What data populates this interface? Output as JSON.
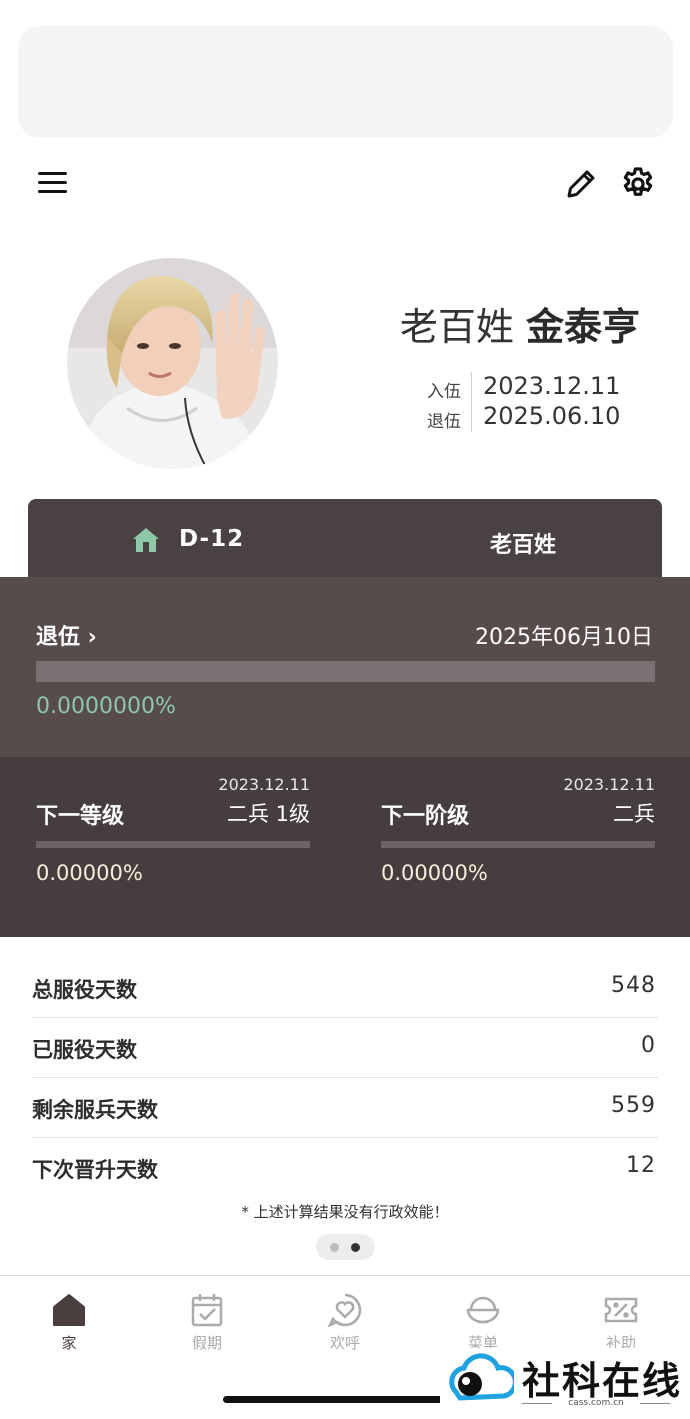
{
  "profile": {
    "rank_prefix": "老百姓",
    "name": "金泰亨",
    "enlist_label": "入伍",
    "enlist_date": "2023.12.11",
    "discharge_label": "退伍",
    "discharge_date": "2025.06.10"
  },
  "tabs": {
    "dday": "D-12",
    "rank": "老百姓"
  },
  "discharge": {
    "title": "退伍",
    "chevron": "›",
    "date": "2025年06月10日",
    "progress": 0.0,
    "percent_text": "0.0000000%"
  },
  "next_level": {
    "title": "下一等级",
    "date": "2023.12.11",
    "rank": "二兵 1级",
    "progress": 0.0,
    "percent_text": "0.00000%"
  },
  "next_stage": {
    "title": "下一阶级",
    "date": "2023.12.11",
    "rank": "二兵",
    "progress": 0.0,
    "percent_text": "0.00000%"
  },
  "stats": [
    {
      "label": "总服役天数",
      "value": "548"
    },
    {
      "label": "已服役天数",
      "value": "0"
    },
    {
      "label": "剩余服兵天数",
      "value": "559"
    },
    {
      "label": "下次晋升天数",
      "value": "12"
    }
  ],
  "disclaimer": "* 上述计算结果没有行政效能！",
  "pager": {
    "pages": 2,
    "current": 2
  },
  "bottom_nav": [
    {
      "label": "家",
      "icon": "home-icon",
      "active": true
    },
    {
      "label": "假期",
      "icon": "calendar-check-icon",
      "active": false
    },
    {
      "label": "欢呼",
      "icon": "heart-bubble-icon",
      "active": false
    },
    {
      "label": "菜单",
      "icon": "rice-bowl-icon",
      "active": false
    },
    {
      "label": "补助",
      "icon": "coupon-icon",
      "active": false
    }
  ],
  "watermark": {
    "text": "社科在线",
    "sub": "cass.com.cn"
  },
  "colors": {
    "tab_bg": "#4a4142",
    "discharge_bg": "#574b4c",
    "next_bg": "#463d3e",
    "accent_green": "#8fc7a9"
  }
}
